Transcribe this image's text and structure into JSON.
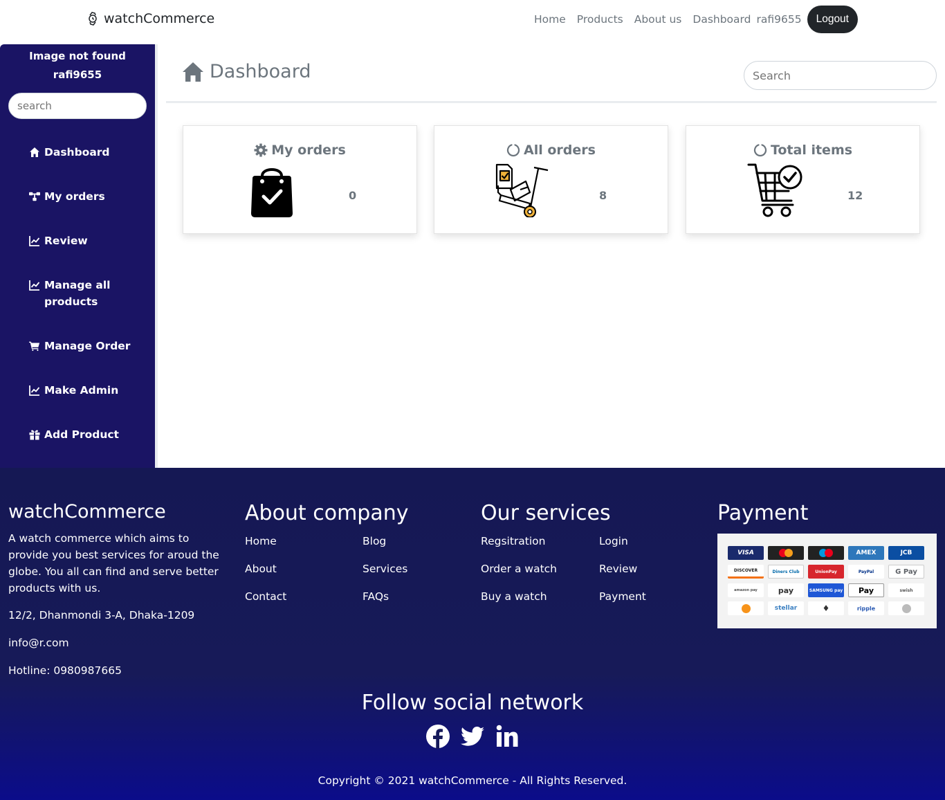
{
  "navbar": {
    "brand": "watchCommerce",
    "links": [
      "Home",
      "Products",
      "About us",
      "Dashboard"
    ],
    "username": "rafi9655",
    "logout": "Logout"
  },
  "sidebar": {
    "image_alt": "Image not found",
    "username": "rafi9655",
    "search_placeholder": "search",
    "items": [
      {
        "label": "Dashboard",
        "icon": "home-icon"
      },
      {
        "label": "My orders",
        "icon": "sitemap-icon"
      },
      {
        "label": "Review",
        "icon": "chart-line-icon"
      },
      {
        "label": "Manage all products",
        "icon": "chart-line-icon"
      },
      {
        "label": "Manage Order",
        "icon": "cart-icon"
      },
      {
        "label": "Make Admin",
        "icon": "chart-line-icon"
      },
      {
        "label": "Add Product",
        "icon": "gift-icon"
      }
    ]
  },
  "main": {
    "title": "Dashboard",
    "search_placeholder": "Search",
    "cards": [
      {
        "title": "My orders",
        "count": "0",
        "icon": "gear-icon",
        "image": "shopping-bag-check"
      },
      {
        "title": "All orders",
        "count": "8",
        "icon": "circle-notch-icon",
        "image": "hand-truck-boxes"
      },
      {
        "title": "Total items",
        "count": "12",
        "icon": "circle-notch-icon",
        "image": "cart-check"
      }
    ]
  },
  "footer": {
    "brand": "watchCommerce",
    "description": "A watch commerce which aims to provide you best services for aroud the globe. You all can find and serve better products with us.",
    "address": "12/2, Dhanmondi 3-A, Dhaka-1209",
    "email": "info@r.com",
    "hotline": "Hotline: 0980987665",
    "about_heading": "About company",
    "about_links": [
      "Home",
      "Blog",
      "About",
      "Services",
      "Contact",
      "FAQs"
    ],
    "services_heading": "Our services",
    "services_links": [
      "Regsitration",
      "Login",
      "Order a watch",
      "Review",
      "Buy a watch",
      "Payment"
    ],
    "payment_heading": "Payment",
    "payment_methods": [
      "VISA",
      "mastercard",
      "maestro",
      "AMEX",
      "JCB",
      "DISCOVER",
      "Diners Club",
      "UnionPay",
      "PayPal",
      "G Pay",
      "amazon pay",
      "pay",
      "SAMSUNG pay",
      "Pay",
      "swish",
      "bitcoin",
      "stellar",
      "ethereum",
      "ripple",
      "litecoin"
    ],
    "follow_heading": "Follow social network",
    "social": [
      "facebook-icon",
      "twitter-icon",
      "linkedin-icon"
    ],
    "copyright": "Copyright © 2021 watchCommerce - All Rights Reserved."
  }
}
